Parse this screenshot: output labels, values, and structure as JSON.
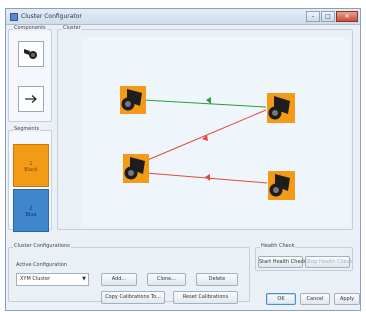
{
  "window": {
    "title": "Cluster Configurator",
    "buttons": {
      "minimize": "–",
      "maximize": "□",
      "close": "✕"
    }
  },
  "components": {
    "label": "Components"
  },
  "segments": {
    "label": "Segments",
    "items": [
      {
        "number": "1",
        "name": "Black",
        "color": "#f39a16"
      },
      {
        "number": "2",
        "name": "Blue",
        "color": "#3f86cc"
      }
    ]
  },
  "cluster": {
    "label": "Cluster",
    "colors": {
      "link_green": "#2f9a3a",
      "link_red": "#e04a3c",
      "device_orange": "#f39a16"
    }
  },
  "cluster_configurations": {
    "label": "Cluster Configurations",
    "active_label": "Active Configuration",
    "selected": "XYM Cluster",
    "buttons": {
      "add": "Add...",
      "clone": "Clone...",
      "delete": "Delete",
      "copy": "Copy Calibrations To...",
      "reset": "Reset Calibrations"
    }
  },
  "health_check": {
    "label": "Health Check",
    "start": "Start Health Check",
    "stop": "Stop Health Check"
  },
  "footer": {
    "ok": "OK",
    "cancel": "Cancel",
    "apply": "Apply"
  }
}
